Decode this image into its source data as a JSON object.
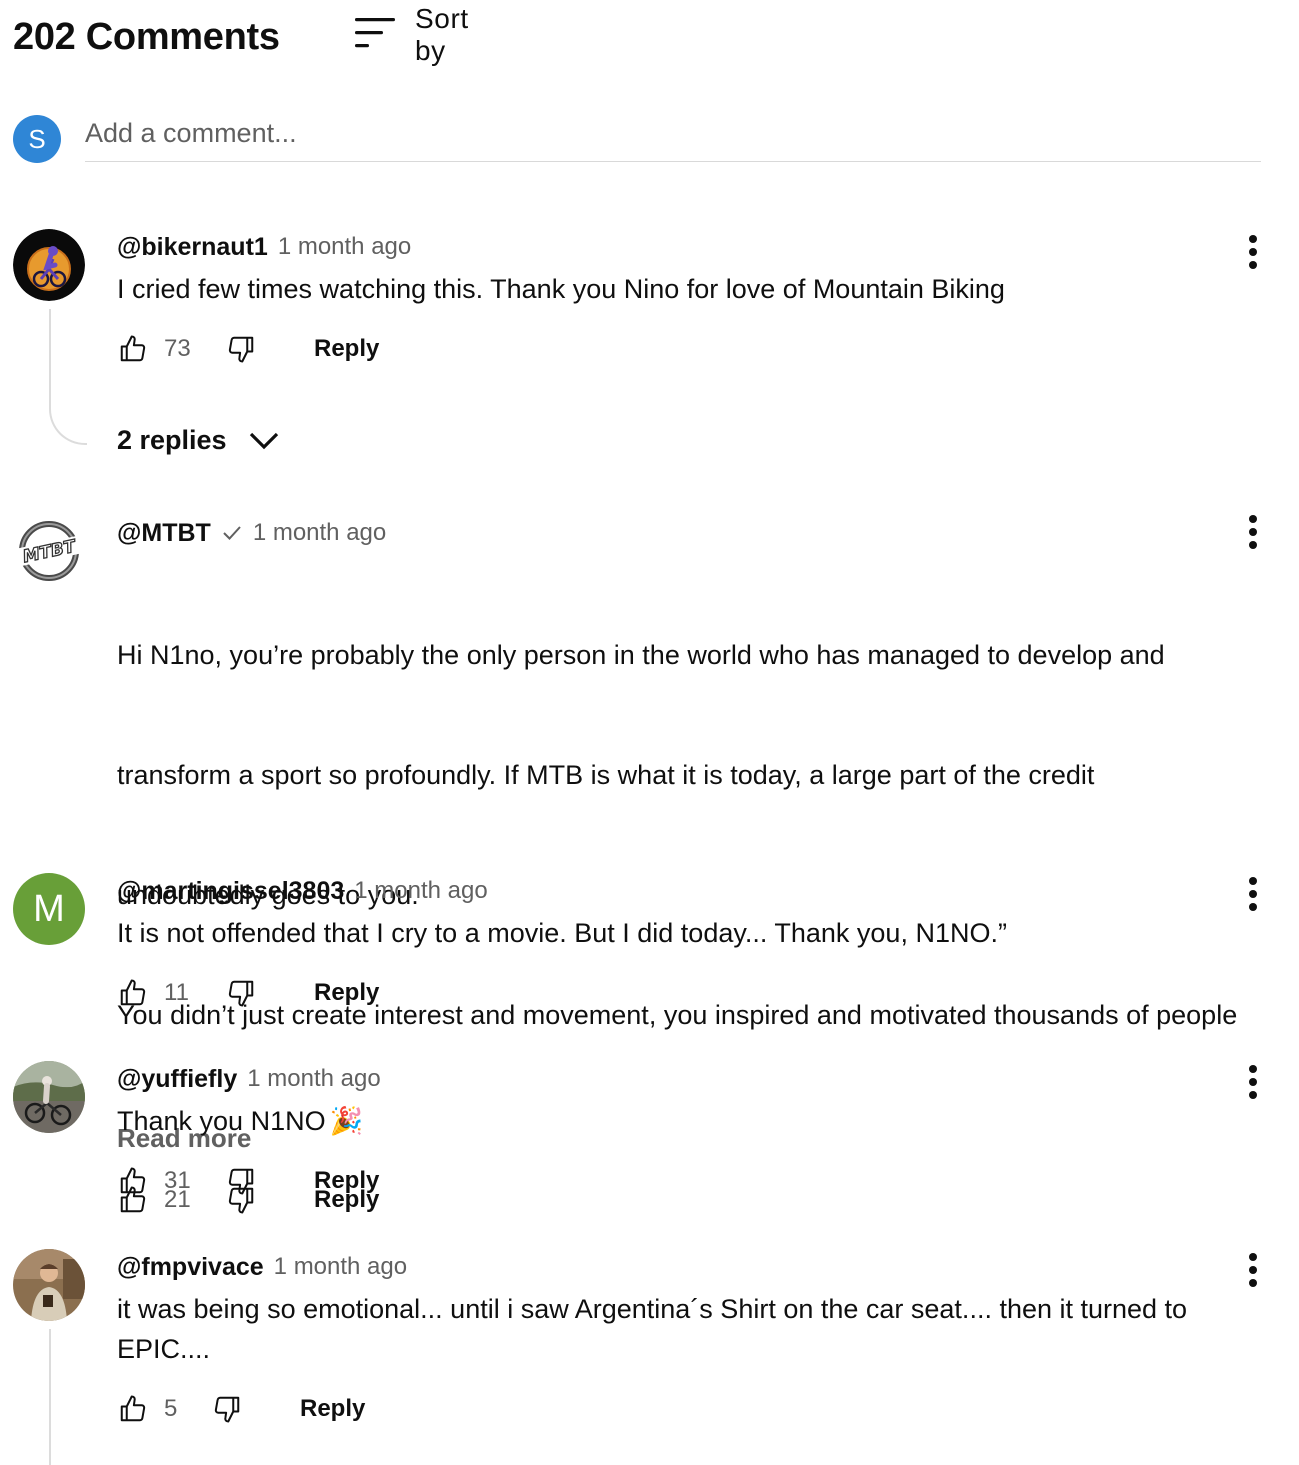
{
  "header": {
    "count_title": "202 Comments",
    "sort_label": "Sort by",
    "sort_icon": "sort-lines-icon"
  },
  "add_comment": {
    "avatar_letter": "S",
    "avatar_color": "#2f86d6",
    "placeholder": "Add a comment..."
  },
  "comments": [
    {
      "author": "@bikernaut1",
      "verified": false,
      "time": "1 month ago",
      "text": "I cried few times watching this. Thank you Nino for love of Mountain Biking",
      "likes": "73",
      "reply_label": "Reply",
      "replies_label": "2 replies",
      "avatar_icon": "cyclist-avatar-icon"
    },
    {
      "author": "@MTBT",
      "verified": true,
      "time": "1 month ago",
      "text_lines": [
        "Hi N1no, you’re probably the only person in the world who has managed to develop and",
        "transform a sport so profoundly. If MTB is what it is today, a large part of the credit",
        "undoubtedly goes to you.",
        "You didn’t just create interest and movement, you inspired and motivated thousands of people"
      ],
      "read_more": "Read more",
      "likes": "21",
      "reply_label": "Reply",
      "avatar_text": "MTBT"
    },
    {
      "author": "@martingissel3803",
      "verified": false,
      "time": "1 month ago",
      "text": "It is not offended that I cry to a movie. But I did today... Thank you, N1NO.”",
      "likes": "11",
      "reply_label": "Reply",
      "avatar_letter": "M",
      "avatar_color": "#689f38"
    },
    {
      "author": "@yuffiefly",
      "verified": false,
      "time": "1 month ago",
      "text": "Thank you N1NO",
      "emoji": "🎉",
      "likes": "31",
      "reply_label": "Reply",
      "avatar_icon": "rider-photo-icon"
    },
    {
      "author": "@fmpvivace",
      "verified": false,
      "time": "1 month ago",
      "text": "it was being so emotional... until i saw Argentina´s Shirt on the car seat.... then it turned to\nEPIC....",
      "likes": "5",
      "reply_label": "Reply",
      "avatar_icon": "person-photo-icon"
    }
  ],
  "icons": {
    "like": "thumbs-up-icon",
    "dislike": "thumbs-down-icon",
    "more": "more-vert-icon",
    "expand": "chevron-down-icon",
    "verified": "checkmark-icon"
  }
}
